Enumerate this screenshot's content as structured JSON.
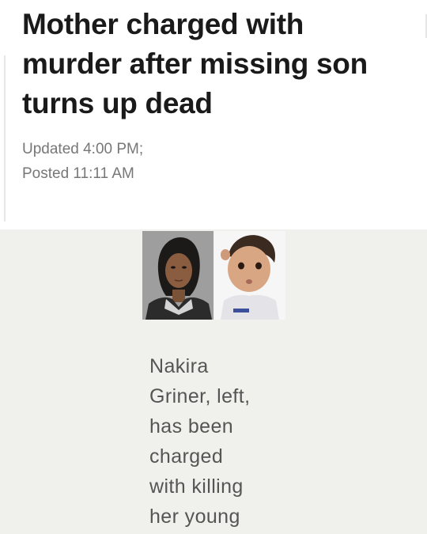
{
  "article": {
    "headline_lines": [
      "Mother charged with",
      "murder after missing son",
      "turns up dead"
    ],
    "updated": "Updated 4:00 PM;",
    "posted": "Posted 11:11 AM"
  },
  "media": {
    "photo_left": "mugshot-photo",
    "photo_right": "child-photo",
    "caption_lines": [
      "Nakira",
      "Griner, left,",
      "has been",
      "charged",
      "with killing",
      "her young"
    ]
  },
  "colors": {
    "headline": "#1a1a1a",
    "meta": "#777777",
    "caption": "#555555",
    "media_bg": "#f0f0ec"
  }
}
